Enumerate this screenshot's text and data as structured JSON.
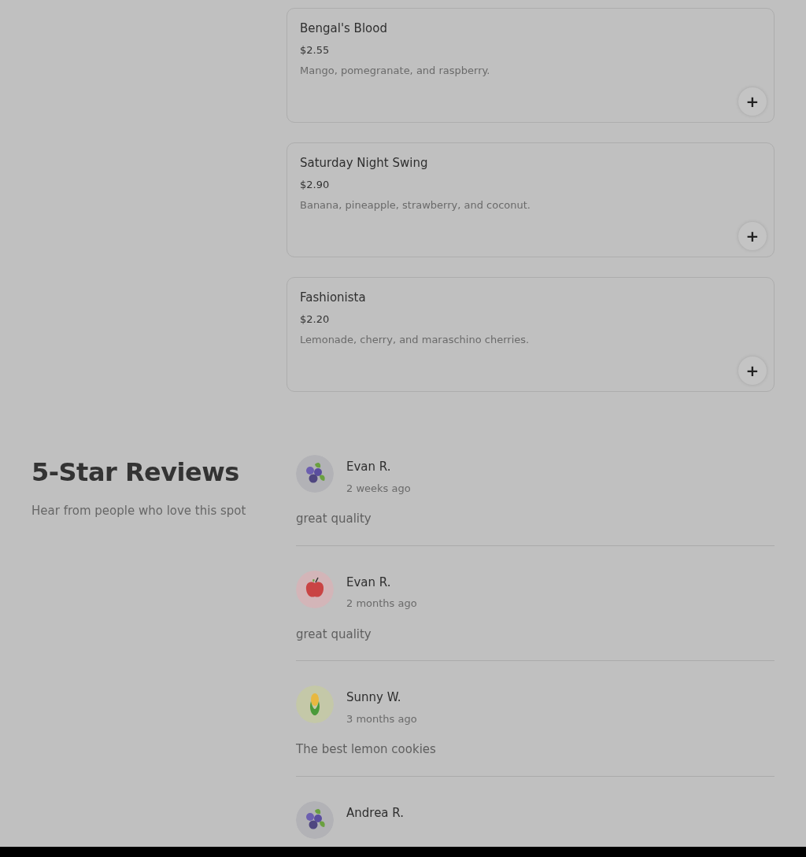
{
  "menu_items": [
    {
      "name": "Bengal's Blood",
      "price": "$2.55",
      "description": "Mango, pomegranate, and raspberry.",
      "add_button": "+"
    },
    {
      "name": "Saturday Night Swing",
      "price": "$2.90",
      "description": "Banana, pineapple, strawberry, and coconut.",
      "add_button": "+"
    },
    {
      "name": "Fashionista",
      "price": "$2.20",
      "description": "Lemonade, cherry, and maraschino cherries.",
      "add_button": "+"
    }
  ],
  "reviews_section": {
    "title": "5-Star Reviews",
    "subtitle": "Hear from people who love this spot"
  },
  "reviews": [
    {
      "kind": "blueberry",
      "name": "Evan R.",
      "time": "2 weeks ago",
      "text": "great quality"
    },
    {
      "kind": "apple",
      "name": "Evan R.",
      "time": "2 months ago",
      "text": "great quality"
    },
    {
      "kind": "corn",
      "name": "Sunny W.",
      "time": "3 months ago",
      "text": "The best lemon cookies"
    },
    {
      "kind": "blueberry",
      "name": "Andrea R."
    }
  ]
}
